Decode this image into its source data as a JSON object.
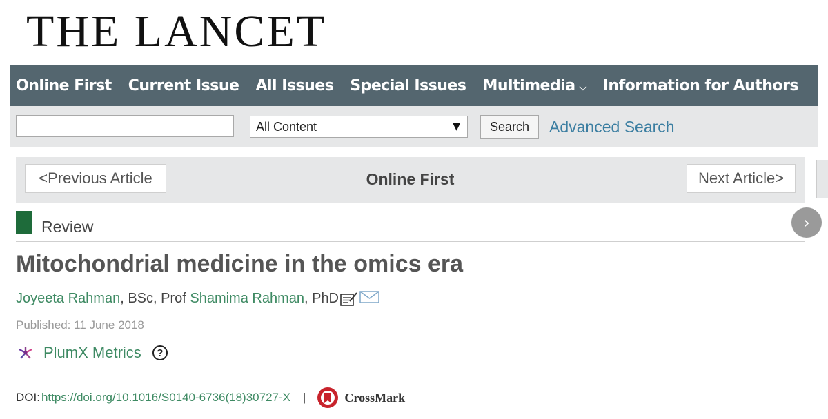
{
  "logo": {
    "text": "THE LANCET"
  },
  "nav": {
    "items": [
      "Online First",
      "Current Issue",
      "All Issues",
      "Special Issues",
      "Multimedia",
      "Information for Authors"
    ],
    "caret": "⌄"
  },
  "search": {
    "query_value": "",
    "scope_selected": "All Content",
    "button_label": "Search",
    "advanced_label": "Advanced Search"
  },
  "article_nav": {
    "prev_label": "<Previous Article",
    "title": "Online First",
    "next_label": "Next Article>"
  },
  "article": {
    "type_label": "Review",
    "type_color": "#1e6b3a",
    "title": "Mitochondrial medicine in the omics era",
    "author1": "Joyeeta Rahman",
    "author1_suffix": ", BSc, Prof ",
    "author2": "Shamima Rahman",
    "author2_suffix": ", PhD",
    "published": "Published: 11 June 2018",
    "plumx_label": "PlumX Metrics",
    "doi_label": "DOI:",
    "doi_link": "https://doi.org/10.1016/S0140-6736(18)30727-X",
    "doi_separator": "|",
    "crossmark_label": "CrossMark"
  },
  "colors": {
    "nav_bg": "#54666f",
    "link_green": "#3e8a63",
    "link_blue": "#3b7ea1"
  }
}
